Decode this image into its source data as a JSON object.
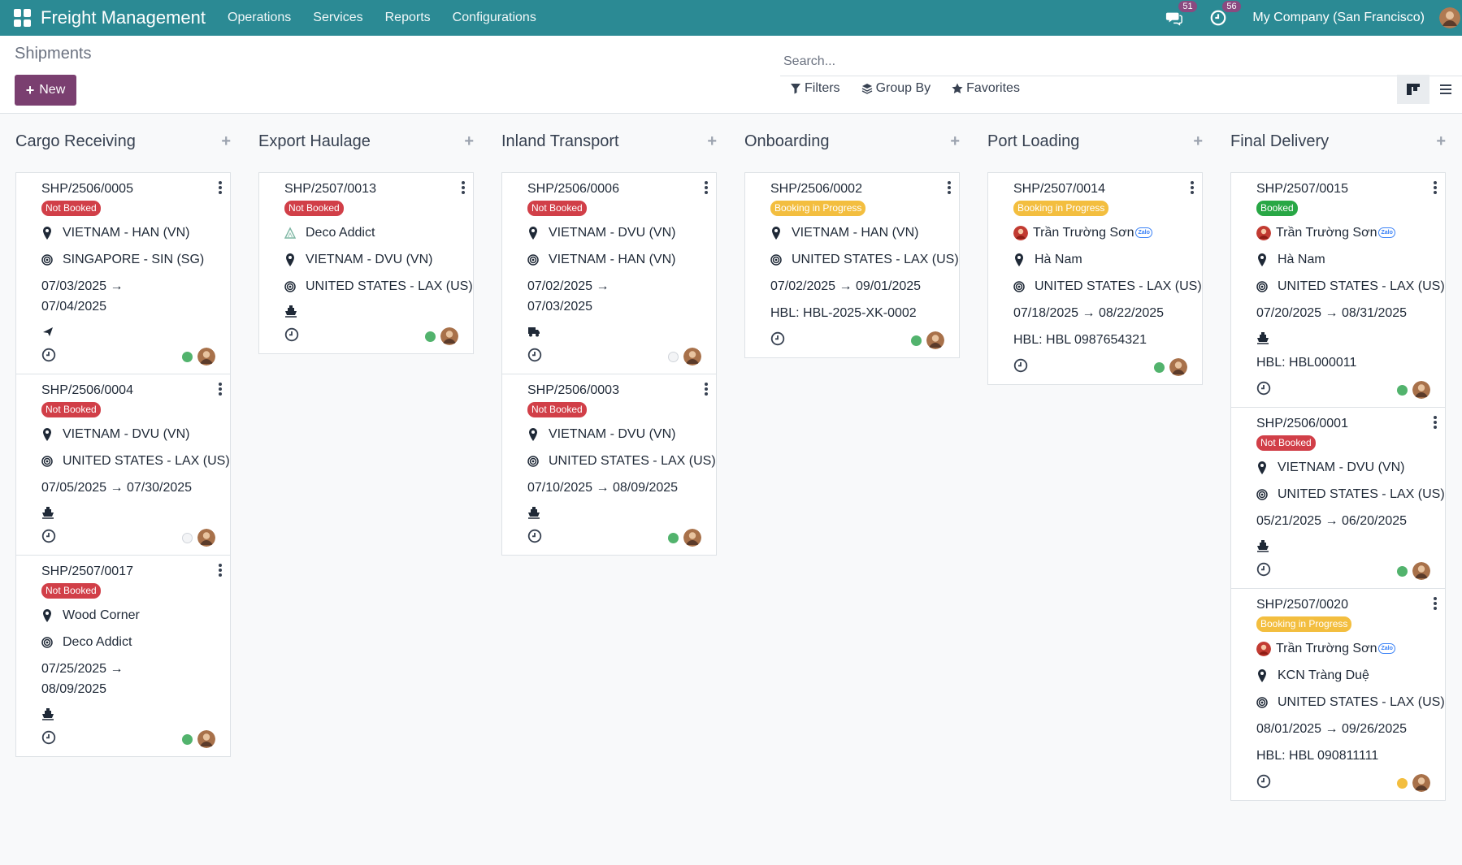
{
  "app": {
    "brand": "Freight Management",
    "menu": [
      "Operations",
      "Services",
      "Reports",
      "Configurations"
    ],
    "messages_count": "51",
    "activities_count": "56",
    "company": "My Company (San Francisco)"
  },
  "control": {
    "title": "Shipments",
    "new_label": "New",
    "search_placeholder": "Search...",
    "filters_label": "Filters",
    "groupby_label": "Group By",
    "favorites_label": "Favorites"
  },
  "colors": {
    "navbar": "#2b8a94",
    "primary": "#7a3f70",
    "badge_red": "#d13f48",
    "badge_yellow": "#f3be3f",
    "badge_green": "#28a745"
  },
  "columns": [
    {
      "title": "Cargo Receiving",
      "cards": [
        {
          "ref": "SHP/2506/0005",
          "badge": "Not Booked",
          "badge_color": "red",
          "lines": [
            {
              "icon": "pin",
              "text": "VIETNAM - HAN (VN)"
            },
            {
              "icon": "target",
              "text": "SINGAPORE - SIN (SG)"
            }
          ],
          "dates1": "07/03/2025 →",
          "dates2": "07/04/2025",
          "transport": "plane",
          "dot": "green"
        },
        {
          "ref": "SHP/2506/0004",
          "badge": "Not Booked",
          "badge_color": "red",
          "lines": [
            {
              "icon": "pin",
              "text": "VIETNAM - DVU (VN)"
            },
            {
              "icon": "target",
              "text": "UNITED STATES - LAX (US)"
            }
          ],
          "dates1": "07/05/2025 → 07/30/2025",
          "dates2": "",
          "transport": "ship",
          "dot": "grey"
        },
        {
          "ref": "SHP/2507/0017",
          "badge": "Not Booked",
          "badge_color": "red",
          "lines": [
            {
              "icon": "pin",
              "text": "Wood Corner"
            },
            {
              "icon": "target",
              "text": "Deco Addict"
            }
          ],
          "dates1": "07/25/2025 →",
          "dates2": "08/09/2025",
          "transport": "ship",
          "dot": "green"
        }
      ]
    },
    {
      "title": "Export Haulage",
      "cards": [
        {
          "ref": "SHP/2507/0013",
          "badge": "Not Booked",
          "badge_color": "red",
          "lines": [
            {
              "icon": "logo",
              "text": "Deco Addict"
            },
            {
              "icon": "pin",
              "text": "VIETNAM - DVU (VN)"
            },
            {
              "icon": "target",
              "text": "UNITED STATES - LAX (US)"
            }
          ],
          "dates1": "",
          "dates2": "",
          "transport": "ship",
          "dot": "green"
        }
      ]
    },
    {
      "title": "Inland Transport",
      "cards": [
        {
          "ref": "SHP/2506/0006",
          "badge": "Not Booked",
          "badge_color": "red",
          "lines": [
            {
              "icon": "pin",
              "text": "VIETNAM - DVU (VN)"
            },
            {
              "icon": "target",
              "text": "VIETNAM - HAN (VN)"
            }
          ],
          "dates1": "07/02/2025 →",
          "dates2": "07/03/2025",
          "transport": "truck",
          "dot": "grey"
        },
        {
          "ref": "SHP/2506/0003",
          "badge": "Not Booked",
          "badge_color": "red",
          "lines": [
            {
              "icon": "pin",
              "text": "VIETNAM - DVU (VN)"
            },
            {
              "icon": "target",
              "text": "UNITED STATES - LAX (US)"
            }
          ],
          "dates1": "07/10/2025 → 08/09/2025",
          "dates2": "",
          "transport": "ship",
          "dot": "green"
        }
      ]
    },
    {
      "title": "Onboarding",
      "cards": [
        {
          "ref": "SHP/2506/0002",
          "badge": "Booking in Progress",
          "badge_color": "yellow",
          "lines": [
            {
              "icon": "pin",
              "text": "VIETNAM - HAN (VN)"
            },
            {
              "icon": "target",
              "text": "UNITED STATES - LAX (US)"
            }
          ],
          "dates1": "07/02/2025 → 09/01/2025",
          "dates2": "",
          "transport": "",
          "hbl": "HBL:  HBL-2025-XK-0002",
          "dot": "green"
        }
      ]
    },
    {
      "title": "Port Loading",
      "cards": [
        {
          "ref": "SHP/2507/0014",
          "badge": "Booking in Progress",
          "badge_color": "yellow",
          "lines": [
            {
              "icon": "person",
              "text": "Trần Trường Sơn",
              "zalo": "Zalo"
            },
            {
              "icon": "pin",
              "text": "Hà Nam"
            },
            {
              "icon": "target",
              "text": "UNITED STATES - LAX (US)"
            }
          ],
          "dates1": "07/18/2025 → 08/22/2025",
          "dates2": "",
          "transport": "",
          "hbl": "HBL:  HBL 0987654321",
          "dot": "green"
        }
      ]
    },
    {
      "title": "Final Delivery",
      "cards": [
        {
          "ref": "SHP/2507/0015",
          "badge": "Booked",
          "badge_color": "green",
          "lines": [
            {
              "icon": "person",
              "text": "Trần Trường Sơn",
              "zalo": "Zalo"
            },
            {
              "icon": "pin",
              "text": "Hà Nam"
            },
            {
              "icon": "target",
              "text": "UNITED STATES - LAX (US)"
            }
          ],
          "dates1": "07/20/2025 → 08/31/2025",
          "dates2": "",
          "transport": "ship",
          "hbl": "HBL:  HBL000011",
          "dot": "green"
        },
        {
          "ref": "SHP/2506/0001",
          "badge": "Not Booked",
          "badge_color": "red",
          "lines": [
            {
              "icon": "pin",
              "text": "VIETNAM - DVU (VN)"
            },
            {
              "icon": "target",
              "text": "UNITED STATES - LAX (US)"
            }
          ],
          "dates1": "05/21/2025 → 06/20/2025",
          "dates2": "",
          "transport": "ship",
          "dot": "green"
        },
        {
          "ref": "SHP/2507/0020",
          "badge": "Booking in Progress",
          "badge_color": "yellow",
          "lines": [
            {
              "icon": "person",
              "text": "Trần Trường Sơn",
              "zalo": "Zalo"
            },
            {
              "icon": "pin",
              "text": "KCN Tràng Duệ"
            },
            {
              "icon": "target",
              "text": "UNITED STATES - LAX (US)"
            }
          ],
          "dates1": "08/01/2025 → 09/26/2025",
          "dates2": "",
          "transport": "",
          "hbl": "HBL:  HBL 090811111",
          "dot": "yellow"
        }
      ]
    }
  ]
}
